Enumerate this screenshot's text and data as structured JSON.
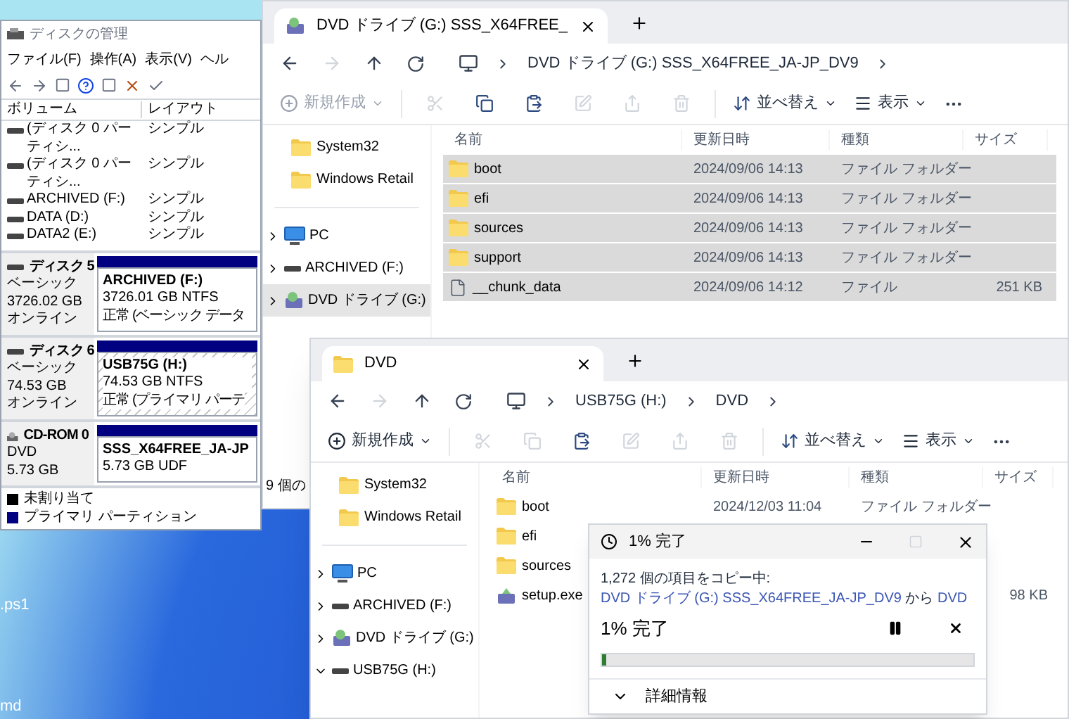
{
  "desktop": {
    "icons": [
      {
        "label": ".ps1"
      },
      {
        "label": "md"
      }
    ]
  },
  "disk_management": {
    "title": "ディスクの管理",
    "menu": [
      "ファイル(F)",
      "操作(A)",
      "表示(V)",
      "ヘル"
    ],
    "volume_table": {
      "columns": [
        "ボリューム",
        "レイアウト"
      ],
      "rows": [
        {
          "volume": "(ディスク 0 パーティシ...",
          "layout": "シンプル"
        },
        {
          "volume": "(ディスク 0 パーティシ...",
          "layout": "シンプル"
        },
        {
          "volume": "ARCHIVED (F:)",
          "layout": "シンプル"
        },
        {
          "volume": "DATA (D:)",
          "layout": "シンプル"
        },
        {
          "volume": "DATA2 (E:)",
          "layout": "シンプル"
        }
      ]
    },
    "disks": [
      {
        "kind": "disk",
        "name": "ディスク 5",
        "type": "ベーシック",
        "size": "3726.02 GB",
        "status": "オンライン",
        "partition": {
          "name": "ARCHIVED  (F:)",
          "info": "3726.01 GB NTFS",
          "status": "正常 (ベーシック データ",
          "selected": false
        }
      },
      {
        "kind": "disk",
        "name": "ディスク 6",
        "type": "ベーシック",
        "size": "74.53 GB",
        "status": "オンライン",
        "partition": {
          "name": "USB75G  (H:)",
          "info": "74.53 GB NTFS",
          "status": "正常 (プライマリ パーテ",
          "selected": true
        }
      },
      {
        "kind": "cdrom",
        "name": "CD-ROM 0",
        "type": "DVD",
        "size": "5.73 GB",
        "partition": {
          "name": "SSS_X64FREE_JA-JP",
          "info": "5.73 GB UDF",
          "selected": false
        }
      }
    ],
    "legend": [
      {
        "label": "未割り当て",
        "color": "#000000"
      },
      {
        "label": "プライマリ パーティション",
        "color": "#000080"
      }
    ]
  },
  "explorers": [
    {
      "tab": {
        "title": "DVD ドライブ (G:) SSS_X64FREE_"
      },
      "breadcrumb": [
        "DVD ドライブ (G:) SSS_X64FREE_JA-JP_DV9"
      ],
      "toolbar": {
        "new": {
          "label": "新規作成",
          "disabled": true
        },
        "actions": [
          {
            "kind": "cut",
            "disabled": true
          },
          {
            "kind": "copy",
            "disabled": false
          },
          {
            "kind": "paste",
            "disabled": false
          },
          {
            "kind": "rename",
            "disabled": true
          },
          {
            "kind": "share",
            "disabled": true
          },
          {
            "kind": "delete",
            "disabled": true
          }
        ],
        "sort": "並べ替え",
        "view": "表示"
      },
      "sidebar": {
        "pinned": [
          {
            "label": "System32",
            "selected": false
          },
          {
            "label": "Windows Retail",
            "selected": false
          }
        ],
        "drives": [
          {
            "label": "PC",
            "kind": "pc",
            "expanded": false,
            "selected": false
          },
          {
            "label": "ARCHIVED (F:)",
            "kind": "drive",
            "expanded": false,
            "selected": false
          },
          {
            "label": "DVD ドライブ (G:)",
            "kind": "dvd",
            "expanded": false,
            "selected": true
          }
        ]
      },
      "columns": [
        "名前",
        "更新日時",
        "種類",
        "サイズ"
      ],
      "files": [
        {
          "name": "boot",
          "kind": "folder",
          "date": "2024/09/06 14:13",
          "type": "ファイル フォルダー",
          "selected": true
        },
        {
          "name": "efi",
          "kind": "folder",
          "date": "2024/09/06 14:13",
          "type": "ファイル フォルダー",
          "selected": true
        },
        {
          "name": "sources",
          "kind": "folder",
          "date": "2024/09/06 14:13",
          "type": "ファイル フォルダー",
          "selected": true
        },
        {
          "name": "support",
          "kind": "folder",
          "date": "2024/09/06 14:13",
          "type": "ファイル フォルダー",
          "selected": true
        },
        {
          "name": "__chunk_data",
          "kind": "file",
          "date": "2024/09/06 14:12",
          "type": "ファイル",
          "size": "251 KB",
          "selected": true
        }
      ],
      "status": "9 個の"
    },
    {
      "tab": {
        "title": "DVD"
      },
      "breadcrumb": [
        "USB75G (H:)",
        "DVD"
      ],
      "toolbar": {
        "new": {
          "label": "新規作成",
          "disabled": false
        },
        "actions": [
          {
            "kind": "cut",
            "disabled": true
          },
          {
            "kind": "copy",
            "disabled": true
          },
          {
            "kind": "paste",
            "disabled": false
          },
          {
            "kind": "rename",
            "disabled": true
          },
          {
            "kind": "share",
            "disabled": true
          },
          {
            "kind": "delete",
            "disabled": true
          }
        ],
        "sort": "並べ替え",
        "view": "表示"
      },
      "sidebar": {
        "pinned": [
          {
            "label": "System32",
            "selected": false
          },
          {
            "label": "Windows Retail",
            "selected": false
          }
        ],
        "drives": [
          {
            "label": "PC",
            "kind": "pc",
            "expanded": false,
            "selected": false
          },
          {
            "label": "ARCHIVED (F:)",
            "kind": "drive",
            "expanded": false,
            "selected": false
          },
          {
            "label": "DVD ドライブ (G:)",
            "kind": "dvd",
            "expanded": false,
            "selected": false
          },
          {
            "label": "USB75G (H:)",
            "kind": "drive",
            "expanded": true,
            "selected": false
          }
        ]
      },
      "columns": [
        "名前",
        "更新日時",
        "種類",
        "サイズ"
      ],
      "files": [
        {
          "name": "boot",
          "kind": "folder",
          "date": "2024/12/03 11:04",
          "type": "ファイル フォルダー",
          "selected": false
        },
        {
          "name": "efi",
          "kind": "folder",
          "selected": false
        },
        {
          "name": "sources",
          "kind": "folder",
          "selected": false
        },
        {
          "name": "setup.exe",
          "kind": "exe",
          "size": "98 KB",
          "selected": false
        }
      ]
    }
  ],
  "copy_dialog": {
    "title": "1% 完了",
    "message_prefix": "1,272 個の項目をコピー中: ",
    "source": "DVD ドライブ (G:) SSS_X64FREE_JA-JP_DV9",
    "between": " から ",
    "destination": "DVD",
    "progress_text": "1% 完了",
    "level": 0.01,
    "details": "詳細情報"
  }
}
